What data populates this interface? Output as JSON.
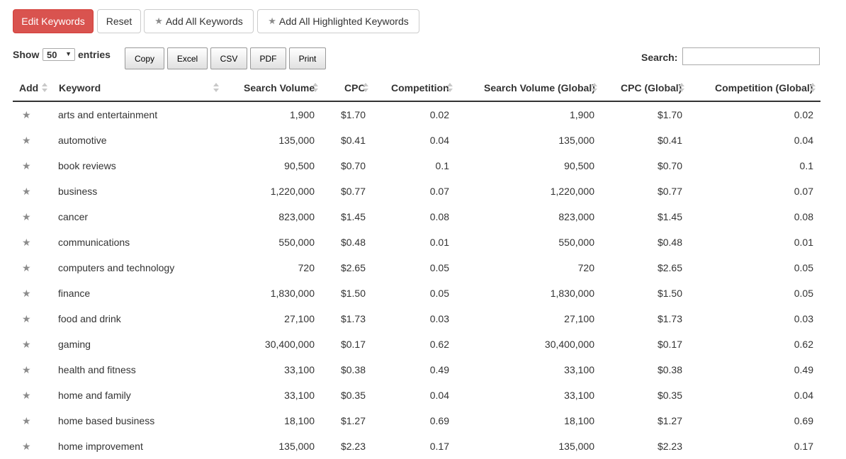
{
  "toolbar": {
    "edit": "Edit Keywords",
    "reset": "Reset",
    "add_all": "Add All Keywords",
    "add_highlighted": "Add All Highlighted Keywords"
  },
  "length": {
    "show": "Show",
    "value": "50",
    "entries": "entries"
  },
  "export": {
    "copy": "Copy",
    "excel": "Excel",
    "csv": "CSV",
    "pdf": "PDF",
    "print": "Print"
  },
  "search": {
    "label": "Search:",
    "value": ""
  },
  "columns": {
    "add": "Add",
    "keyword": "Keyword",
    "volume": "Search Volume",
    "cpc": "CPC",
    "competition": "Competition",
    "volume_global": "Search Volume (Global)",
    "cpc_global": "CPC (Global)",
    "competition_global": "Competition (Global)"
  },
  "rows": [
    {
      "keyword": "arts and entertainment",
      "volume": "1,900",
      "cpc": "$1.70",
      "competition": "0.02",
      "volume_global": "1,900",
      "cpc_global": "$1.70",
      "competition_global": "0.02"
    },
    {
      "keyword": "automotive",
      "volume": "135,000",
      "cpc": "$0.41",
      "competition": "0.04",
      "volume_global": "135,000",
      "cpc_global": "$0.41",
      "competition_global": "0.04"
    },
    {
      "keyword": "book reviews",
      "volume": "90,500",
      "cpc": "$0.70",
      "competition": "0.1",
      "volume_global": "90,500",
      "cpc_global": "$0.70",
      "competition_global": "0.1"
    },
    {
      "keyword": "business",
      "volume": "1,220,000",
      "cpc": "$0.77",
      "competition": "0.07",
      "volume_global": "1,220,000",
      "cpc_global": "$0.77",
      "competition_global": "0.07"
    },
    {
      "keyword": "cancer",
      "volume": "823,000",
      "cpc": "$1.45",
      "competition": "0.08",
      "volume_global": "823,000",
      "cpc_global": "$1.45",
      "competition_global": "0.08"
    },
    {
      "keyword": "communications",
      "volume": "550,000",
      "cpc": "$0.48",
      "competition": "0.01",
      "volume_global": "550,000",
      "cpc_global": "$0.48",
      "competition_global": "0.01"
    },
    {
      "keyword": "computers and technology",
      "volume": "720",
      "cpc": "$2.65",
      "competition": "0.05",
      "volume_global": "720",
      "cpc_global": "$2.65",
      "competition_global": "0.05"
    },
    {
      "keyword": "finance",
      "volume": "1,830,000",
      "cpc": "$1.50",
      "competition": "0.05",
      "volume_global": "1,830,000",
      "cpc_global": "$1.50",
      "competition_global": "0.05"
    },
    {
      "keyword": "food and drink",
      "volume": "27,100",
      "cpc": "$1.73",
      "competition": "0.03",
      "volume_global": "27,100",
      "cpc_global": "$1.73",
      "competition_global": "0.03"
    },
    {
      "keyword": "gaming",
      "volume": "30,400,000",
      "cpc": "$0.17",
      "competition": "0.62",
      "volume_global": "30,400,000",
      "cpc_global": "$0.17",
      "competition_global": "0.62"
    },
    {
      "keyword": "health and fitness",
      "volume": "33,100",
      "cpc": "$0.38",
      "competition": "0.49",
      "volume_global": "33,100",
      "cpc_global": "$0.38",
      "competition_global": "0.49"
    },
    {
      "keyword": "home and family",
      "volume": "33,100",
      "cpc": "$0.35",
      "competition": "0.04",
      "volume_global": "33,100",
      "cpc_global": "$0.35",
      "competition_global": "0.04"
    },
    {
      "keyword": "home based business",
      "volume": "18,100",
      "cpc": "$1.27",
      "competition": "0.69",
      "volume_global": "18,100",
      "cpc_global": "$1.27",
      "competition_global": "0.69"
    },
    {
      "keyword": "home improvement",
      "volume": "135,000",
      "cpc": "$2.23",
      "competition": "0.17",
      "volume_global": "135,000",
      "cpc_global": "$2.23",
      "competition_global": "0.17"
    }
  ]
}
